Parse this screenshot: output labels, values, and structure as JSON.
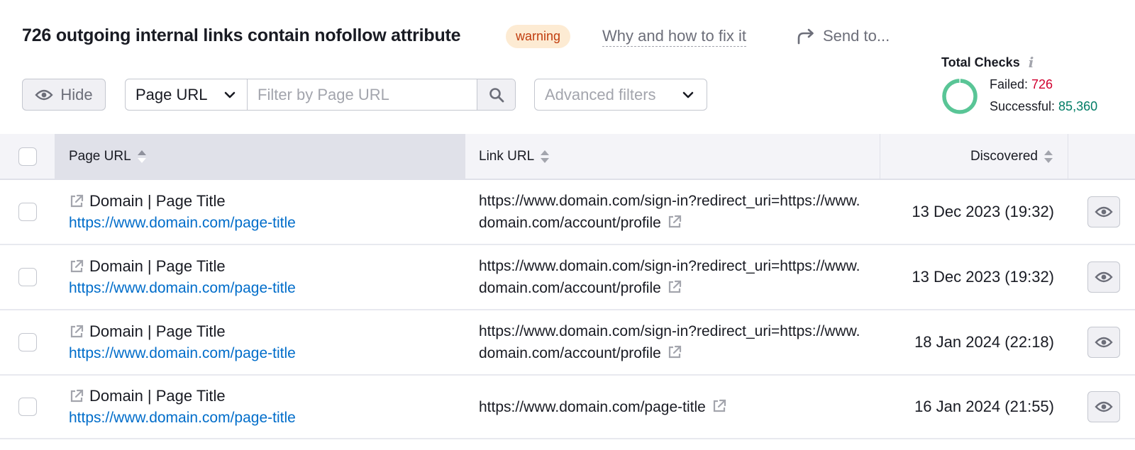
{
  "header": {
    "title": "726 outgoing internal links contain nofollow attribute",
    "badge": "warning",
    "fix_link": "Why and how to fix it",
    "send_to": "Send to..."
  },
  "total_checks": {
    "title": "Total Checks",
    "info_icon": "i",
    "failed_label": "Failed: ",
    "failed_value": "726",
    "success_label": "Successful: ",
    "success_value": "85,360",
    "failed_count": 726,
    "success_count": 85360,
    "colors": {
      "failed": "#d1002f",
      "success": "#59c596"
    }
  },
  "toolbar": {
    "hide_label": "Hide",
    "filter_select": "Page URL",
    "filter_placeholder": "Filter by Page URL",
    "filter_value": "",
    "advanced_filters": "Advanced filters"
  },
  "table": {
    "columns": [
      "Page URL",
      "Link URL",
      "Discovered"
    ],
    "rows": [
      {
        "page_title": "Domain | Page Title",
        "page_url": "https://www.domain.com/page-title",
        "link_url": "https://www.domain.com/sign-in?redirect_uri=https://www.domain.com/account/profile",
        "discovered": "13 Dec 2023 (19:32)"
      },
      {
        "page_title": "Domain | Page Title",
        "page_url": "https://www.domain.com/page-title",
        "link_url": "https://www.domain.com/sign-in?redirect_uri=https://www.domain.com/account/profile",
        "discovered": "13 Dec 2023 (19:32)"
      },
      {
        "page_title": "Domain | Page Title",
        "page_url": "https://www.domain.com/page-title",
        "link_url": "https://www.domain.com/sign-in?redirect_uri=https://www.domain.com/account/profile",
        "discovered": "18 Jan 2024 (22:18)"
      },
      {
        "page_title": "Domain | Page Title",
        "page_url": "https://www.domain.com/page-title",
        "link_url": "https://www.domain.com/page-title",
        "discovered": "16 Jan 2024 (21:55)"
      }
    ]
  },
  "icons": {
    "hide": "eye-icon",
    "send": "share-arrow-icon",
    "search": "magnifier-icon",
    "external": "external-link-icon",
    "view": "eye-icon",
    "sort": "sort-arrows-icon",
    "chevron": "chevron-down-icon"
  }
}
